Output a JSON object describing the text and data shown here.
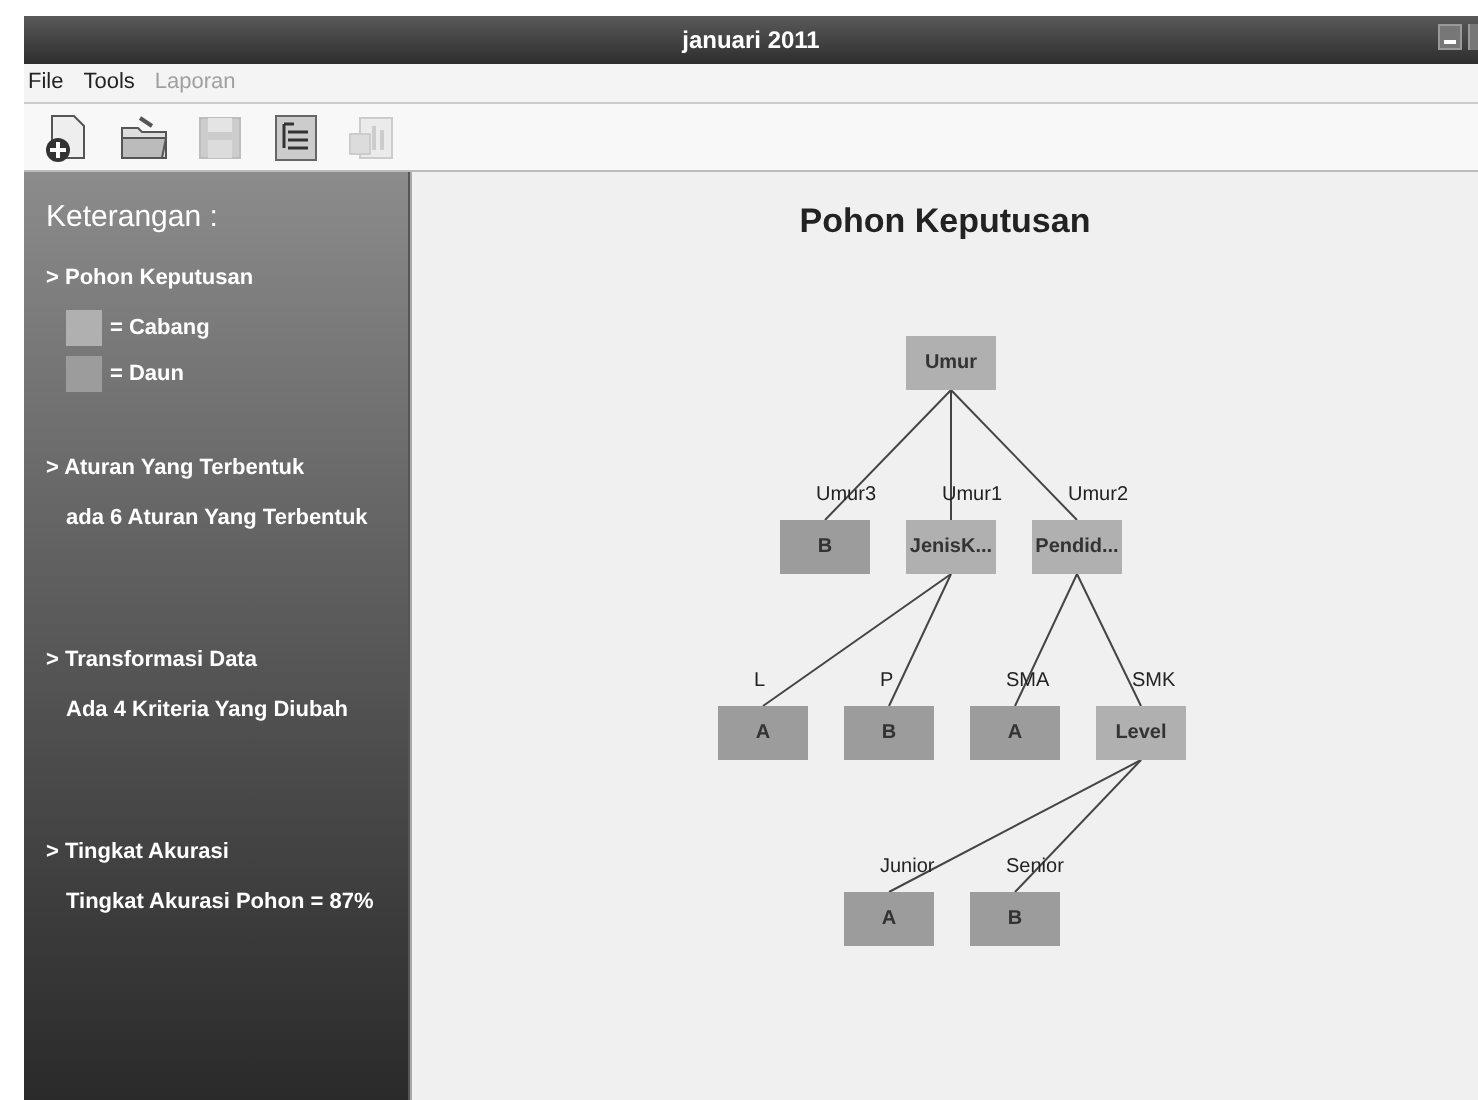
{
  "window": {
    "title": "januari 2011"
  },
  "menu": [
    {
      "label": "File",
      "disabled": false
    },
    {
      "label": "Tools",
      "disabled": false
    },
    {
      "label": "Laporan",
      "disabled": true
    }
  ],
  "toolbar": [
    {
      "kind": "new",
      "disabled": false
    },
    {
      "kind": "open",
      "disabled": false
    },
    {
      "kind": "save",
      "disabled": true
    },
    {
      "kind": "tree",
      "disabled": false
    },
    {
      "kind": "report",
      "disabled": true
    }
  ],
  "legend": {
    "title": "Keterangan :",
    "sections": [
      {
        "heading": "> Pohon Keputusan",
        "items": [
          {
            "kind": "swatch",
            "color": "#b0b0b0",
            "label": "= Cabang"
          },
          {
            "kind": "swatch",
            "color": "#9c9c9c",
            "label": "= Daun"
          }
        ]
      },
      {
        "heading": "> Aturan Yang Terbentuk",
        "items": [
          {
            "kind": "text",
            "label": "ada 6 Aturan Yang Terbentuk"
          }
        ]
      },
      {
        "heading": "> Transformasi Data",
        "items": [
          {
            "kind": "text",
            "label": "Ada 4 Kriteria Yang Diubah"
          }
        ]
      },
      {
        "heading": "> Tingkat Akurasi",
        "items": [
          {
            "kind": "text",
            "label": "Tingkat Akurasi Pohon = 87%"
          }
        ]
      }
    ]
  },
  "tree": {
    "title": "Pohon Keputusan",
    "root": {
      "label": "Umur",
      "kind": "branch",
      "children": [
        {
          "edge": "Umur3",
          "label": "B",
          "kind": "leaf"
        },
        {
          "edge": "Umur1",
          "label": "JenisK...",
          "kind": "branch",
          "children": [
            {
              "edge": "L",
              "label": "A",
              "kind": "leaf"
            },
            {
              "edge": "P",
              "label": "B",
              "kind": "leaf"
            }
          ]
        },
        {
          "edge": "Umur2",
          "label": "Pendid...",
          "kind": "branch",
          "children": [
            {
              "edge": "SMA",
              "label": "A",
              "kind": "leaf"
            },
            {
              "edge": "SMK",
              "label": "Level",
              "kind": "branch",
              "children": [
                {
                  "edge": "Junior",
                  "label": "A",
                  "kind": "leaf"
                },
                {
                  "edge": "Senior",
                  "label": "B",
                  "kind": "leaf"
                }
              ]
            }
          ]
        }
      ]
    }
  }
}
